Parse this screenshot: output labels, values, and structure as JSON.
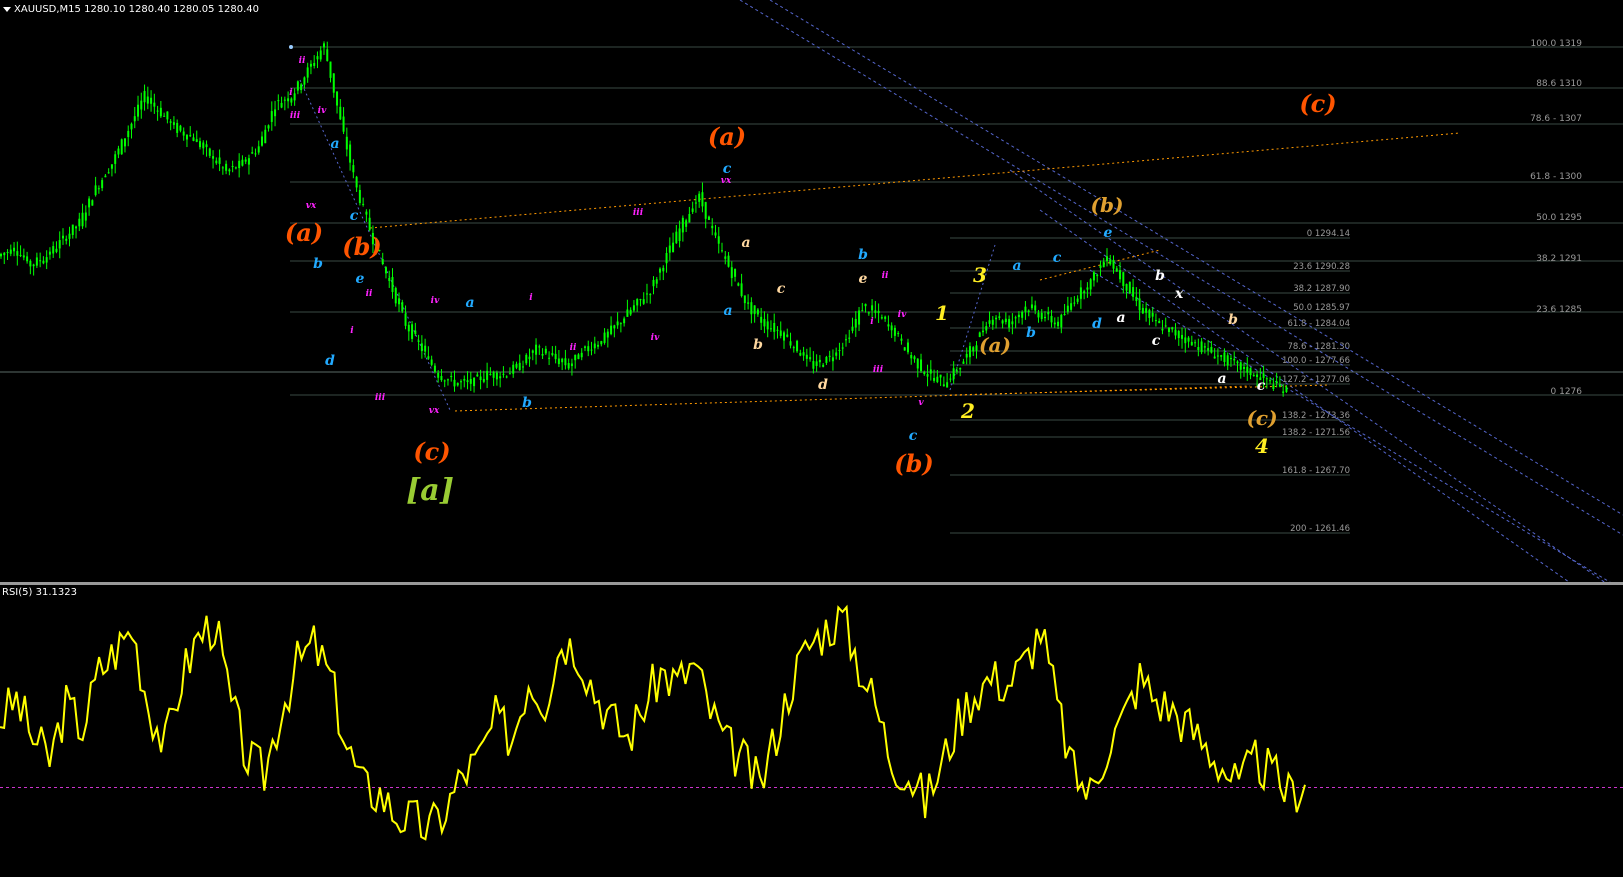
{
  "window": {
    "symbol_header": "XAUUSD,M15  1280.10 1280.40 1280.05 1280.40",
    "rsi_header": "RSI(5) 31.1323"
  },
  "colors": {
    "background": "#000000",
    "candles": "#00ff00",
    "rsi_line": "#ffff00",
    "rsi_level": "#cc33cc",
    "fib_lines": "#3a4a44",
    "fib_text": "#9a9a9a",
    "channel": "#5566cc",
    "trend_dotted": "#ff9900",
    "separator": "#888888",
    "wave_orange": "#ff5500",
    "wave_cyan": "#22aaff",
    "wave_magenta": "#ff22ff",
    "wave_white": "#ffffff",
    "wave_peach": "#ffd8a0",
    "wave_yellow": "#ffee22",
    "wave_gold": "#e0a030",
    "wave_green": "#99cc33"
  },
  "fib_right_labels": [
    "100.0 1319",
    "88.6 1310",
    "78.6 - 1307",
    "61.8 - 1300",
    "50.0 1295",
    "38.2 1291",
    "23.6 1285",
    "0 1276"
  ],
  "fib_inner_labels": [
    "0 1294.14",
    "23.6 1290.28",
    "38.2 1287.90",
    "50.0 1285.97",
    "61.8 - 1284.04",
    "78.6 - 1281.30",
    "100.0 - 1277.66",
    "127.2 - 1277.06",
    "138.2 - 1273.36",
    "138.2 - 1271.56",
    "161.8 - 1267.70",
    "200 - 1261.46"
  ],
  "wave_labels": [
    {
      "text": "ii",
      "color": "magenta",
      "size": "xs"
    },
    {
      "text": "i",
      "color": "magenta",
      "size": "xs"
    },
    {
      "text": "iii",
      "color": "magenta",
      "size": "xs"
    },
    {
      "text": "iv",
      "color": "magenta",
      "size": "xs"
    },
    {
      "text": "a",
      "color": "cyan",
      "size": "s"
    },
    {
      "text": "vx",
      "color": "magenta",
      "size": "xs"
    },
    {
      "text": "c",
      "color": "cyan",
      "size": "s"
    },
    {
      "text": "(a)",
      "color": "orange",
      "size": "l"
    },
    {
      "text": "(b)",
      "color": "orange",
      "size": "l"
    },
    {
      "text": "b",
      "color": "cyan",
      "size": "s"
    },
    {
      "text": "e",
      "color": "cyan",
      "size": "s"
    },
    {
      "text": "ii",
      "color": "magenta",
      "size": "xs"
    },
    {
      "text": "i",
      "color": "magenta",
      "size": "xs"
    },
    {
      "text": "d",
      "color": "cyan",
      "size": "s"
    },
    {
      "text": "iii",
      "color": "magenta",
      "size": "xs"
    },
    {
      "text": "iv",
      "color": "magenta",
      "size": "xs"
    },
    {
      "text": "vx",
      "color": "magenta",
      "size": "xs"
    },
    {
      "text": "(c)",
      "color": "orange",
      "size": "l"
    },
    {
      "text": "[a]",
      "color": "green",
      "size": "xl"
    },
    {
      "text": "a",
      "color": "cyan",
      "size": "s"
    },
    {
      "text": "b",
      "color": "cyan",
      "size": "s"
    },
    {
      "text": "i",
      "color": "magenta",
      "size": "xs"
    },
    {
      "text": "ii",
      "color": "magenta",
      "size": "xs"
    },
    {
      "text": "iii",
      "color": "magenta",
      "size": "xs"
    },
    {
      "text": "iv",
      "color": "magenta",
      "size": "xs"
    },
    {
      "text": "(a)",
      "color": "orange",
      "size": "l"
    },
    {
      "text": "c",
      "color": "cyan",
      "size": "s"
    },
    {
      "text": "vx",
      "color": "magenta",
      "size": "xs"
    },
    {
      "text": "a",
      "color": "peach",
      "size": "s"
    },
    {
      "text": "a",
      "color": "cyan",
      "size": "s"
    },
    {
      "text": "b",
      "color": "peach",
      "size": "s"
    },
    {
      "text": "c",
      "color": "peach",
      "size": "s"
    },
    {
      "text": "d",
      "color": "peach",
      "size": "s"
    },
    {
      "text": "b",
      "color": "cyan",
      "size": "s"
    },
    {
      "text": "e",
      "color": "peach",
      "size": "s"
    },
    {
      "text": "ii",
      "color": "magenta",
      "size": "xs"
    },
    {
      "text": "i",
      "color": "magenta",
      "size": "xs"
    },
    {
      "text": "iv",
      "color": "magenta",
      "size": "xs"
    },
    {
      "text": "iii",
      "color": "magenta",
      "size": "xs"
    },
    {
      "text": "v",
      "color": "magenta",
      "size": "xs"
    },
    {
      "text": "c",
      "color": "cyan",
      "size": "s"
    },
    {
      "text": "(b)",
      "color": "orange",
      "size": "l"
    },
    {
      "text": "1",
      "color": "yellow",
      "size": "m"
    },
    {
      "text": "2",
      "color": "yellow",
      "size": "m"
    },
    {
      "text": "3",
      "color": "yellow",
      "size": "m"
    },
    {
      "text": "(a)",
      "color": "gold",
      "size": "m"
    },
    {
      "text": "a",
      "color": "cyan",
      "size": "s"
    },
    {
      "text": "b",
      "color": "cyan",
      "size": "s"
    },
    {
      "text": "c",
      "color": "cyan",
      "size": "s"
    },
    {
      "text": "d",
      "color": "cyan",
      "size": "s"
    },
    {
      "text": "e",
      "color": "cyan",
      "size": "s"
    },
    {
      "text": "(b)",
      "color": "gold",
      "size": "m"
    },
    {
      "text": "a",
      "color": "white",
      "size": "s"
    },
    {
      "text": "b",
      "color": "white",
      "size": "s"
    },
    {
      "text": "x",
      "color": "white",
      "size": "s"
    },
    {
      "text": "c",
      "color": "white",
      "size": "s"
    },
    {
      "text": "b",
      "color": "peach",
      "size": "s"
    },
    {
      "text": "a",
      "color": "white",
      "size": "s"
    },
    {
      "text": "c",
      "color": "white",
      "size": "s"
    },
    {
      "text": "(c)",
      "color": "gold",
      "size": "m"
    },
    {
      "text": "4",
      "color": "yellow",
      "size": "m"
    },
    {
      "text": "(c)",
      "color": "orange",
      "size": "l"
    }
  ],
  "chart_data": [
    {
      "type": "line",
      "title": "XAUUSD,M15  1280.10 1280.40 1280.05 1280.40",
      "note_style": "candlestick",
      "series": [
        {
          "name": "XAUUSD,M15",
          "values": [
            1294,
            1295,
            1293,
            1294,
            1296,
            1298,
            1302,
            1305,
            1309,
            1313,
            1311,
            1309,
            1308,
            1306,
            1304,
            1305,
            1307,
            1312,
            1313,
            1316,
            1319,
            1310,
            1302,
            1296,
            1291,
            1286,
            1283,
            1280,
            1279,
            1279,
            1280,
            1280,
            1281,
            1283,
            1282,
            1281,
            1283,
            1284,
            1286,
            1288,
            1290,
            1294,
            1298,
            1301,
            1296,
            1292,
            1288,
            1286,
            1285,
            1283,
            1281,
            1282,
            1284,
            1288,
            1287,
            1285,
            1282,
            1280,
            1279,
            1281,
            1284,
            1287,
            1286,
            1288,
            1287,
            1286,
            1289,
            1291,
            1294,
            1291,
            1288,
            1286,
            1285,
            1284,
            1283,
            1282,
            1281,
            1280,
            1279,
            1278
          ]
        }
      ],
      "ylim": [
        1258,
        1322
      ]
    },
    {
      "type": "line",
      "title": "RSI(5) 31.1323",
      "series": [
        {
          "name": "RSI(5)",
          "values": [
            55,
            62,
            48,
            40,
            60,
            52,
            72,
            80,
            88,
            60,
            45,
            70,
            85,
            90,
            60,
            40,
            35,
            58,
            75,
            82,
            70,
            45,
            30,
            28,
            20,
            18,
            15,
            22,
            35,
            40,
            55,
            48,
            70,
            62,
            84,
            80,
            65,
            55,
            48,
            60,
            72,
            68,
            75,
            58,
            45,
            40,
            30,
            50,
            70,
            82,
            88,
            92,
            75,
            60,
            40,
            35,
            25,
            38,
            55,
            65,
            70,
            68,
            75,
            88,
            60,
            35,
            28,
            45,
            55,
            70,
            62,
            58,
            52,
            45,
            38,
            30,
            40,
            35,
            28,
            31
          ]
        }
      ],
      "ylim": [
        0,
        100
      ],
      "levels": [
        30
      ]
    }
  ]
}
